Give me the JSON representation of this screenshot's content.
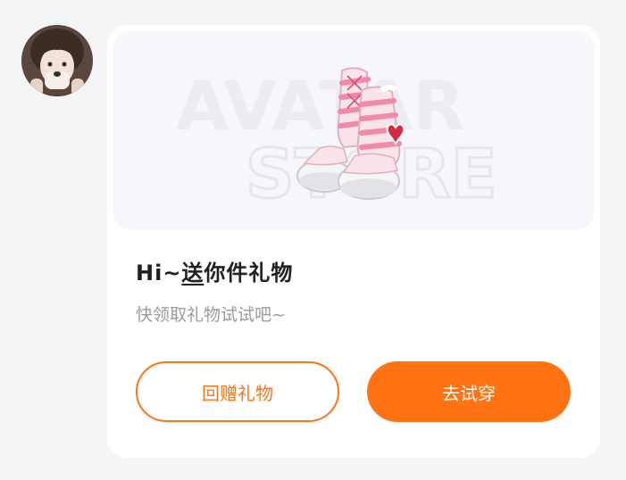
{
  "sender": {
    "avatar_icon": "user-avatar-photo"
  },
  "gift_card": {
    "banner": {
      "watermark_line1": "AVATAR",
      "watermark_line2": "STORE",
      "item_icon": "striped-leg-warmer-boots"
    },
    "title_prefix": "Hi~",
    "title_highlight": "送",
    "title_suffix": "你件礼物",
    "subtitle": "快领取礼物试试吧~",
    "buttons": {
      "return_gift": "回赠礼物",
      "try_on": "去试穿"
    }
  },
  "colors": {
    "accent": "#ff7314",
    "page_background": "#f4f5f7",
    "card_background": "#ffffff",
    "title_text": "#1f1f24",
    "subtitle_text": "#9a9aa2"
  }
}
